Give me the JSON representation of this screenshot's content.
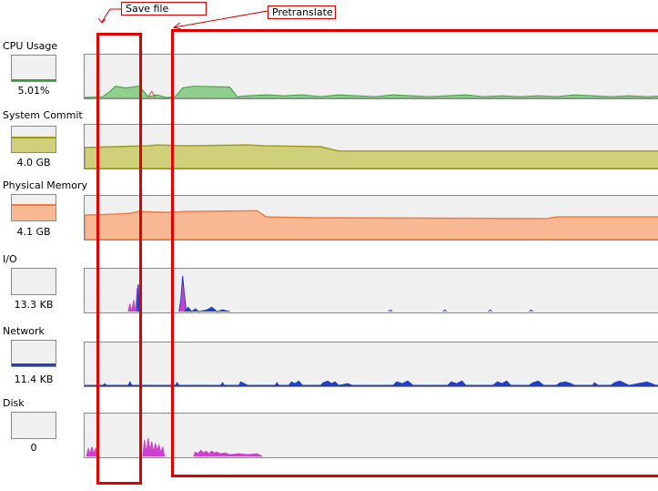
{
  "annotations": {
    "save_file": "Save file",
    "pretranslate": "Pretranslate"
  },
  "metrics": [
    {
      "key": "cpu",
      "label": "CPU Usage",
      "value": "5.01%",
      "color": "#3c9b3c",
      "fill_color": "#8fce8f"
    },
    {
      "key": "commit",
      "label": "System Commit",
      "value": "4.0 GB",
      "color": "#9a9a14",
      "fill_color": "#d0d07a"
    },
    {
      "key": "memory",
      "label": "Physical Memory",
      "value": "4.1 GB",
      "color": "#f07a3c",
      "fill_color": "#f8b894"
    },
    {
      "key": "io",
      "label": "I/O",
      "value": "13.3  KB",
      "color": "#2040c8",
      "fill_color": "#d040d0"
    },
    {
      "key": "network",
      "label": "Network",
      "value": "11.4  KB",
      "color": "#2040c8",
      "fill_color": "#2040c8"
    },
    {
      "key": "disk",
      "label": "Disk",
      "value": "0",
      "color": "#d040d0",
      "fill_color": "#d040d0"
    }
  ],
  "colors": {
    "annotation_red": "#e00000",
    "graph_bg": "#f0f0f0",
    "graph_border": "#8a8a8a"
  }
}
